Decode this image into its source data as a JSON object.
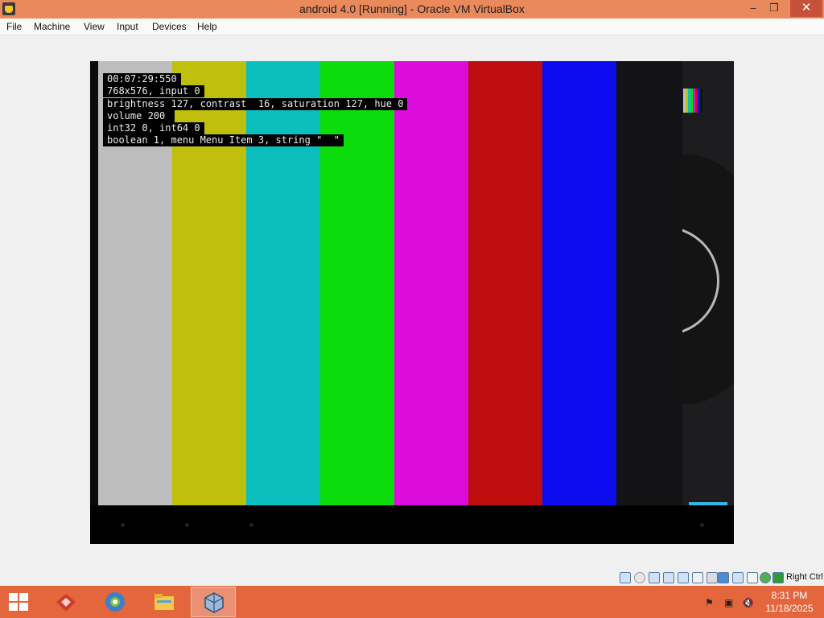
{
  "window": {
    "title": "android 4.0 [Running] - Oracle VM VirtualBox",
    "icons": {
      "app": "virtualbox-app-icon",
      "minimize": "minimize-icon",
      "maximize": "restore-icon",
      "close": "close-icon"
    },
    "buttons": {
      "minimize": "–",
      "restore": "❐",
      "close": "✕"
    }
  },
  "menu": {
    "file": "File",
    "machine": "Machine",
    "view": "View",
    "input": "Input",
    "devices": "Devices",
    "help": "Help"
  },
  "vm_screen": {
    "color_bars": [
      "#bdbdbd",
      "#bfbf0c",
      "#0cbfbf",
      "#0cdc0c",
      "#dc0cdc",
      "#bf0c0c",
      "#0c0cee",
      "#131316"
    ],
    "osd": [
      "00:07:29:550",
      "768x576, input 0",
      "brightness 127, contrast  16, saturation 127, hue 0",
      "volume 200 ",
      "int32 0, int64 0",
      "boolean 1, menu Menu Item 3, string \"  \""
    ]
  },
  "status_bar": {
    "host_key": "Right Ctrl",
    "icons": [
      "hard-disk-icon",
      "optical-drive-icon",
      "audio-icon",
      "network-icon",
      "usb-icon",
      "shared-folders-icon",
      "display-icon",
      "video-capture-icon",
      "guest-additions-icon",
      "capture-icon",
      "virtualization-icon",
      "mouse-integration-icon"
    ]
  },
  "taskbar": {
    "apps": [
      "start-icon",
      "toolbox-app-icon",
      "browser-app-icon",
      "file-explorer-icon",
      "virtualbox-taskbar-icon"
    ],
    "tray_icons": [
      "action-center-icon",
      "network-icon",
      "volume-muted-icon"
    ],
    "time": "8:31 PM",
    "date": "11/18/2025"
  }
}
